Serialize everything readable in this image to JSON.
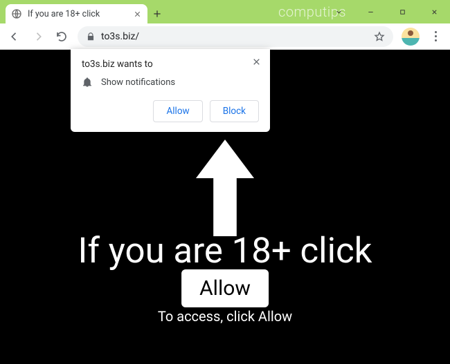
{
  "titlebar": {
    "watermark": "computips",
    "tab": {
      "title": "If you are 18+ click"
    }
  },
  "toolbar": {
    "url": "to3s.biz/"
  },
  "permission": {
    "title": "to3s.biz wants to",
    "item": "Show notifications",
    "allow": "Allow",
    "block": "Block"
  },
  "page": {
    "headline": "If you are 18+ click",
    "allow_button": "Allow",
    "subline": "To access, click Allow"
  }
}
